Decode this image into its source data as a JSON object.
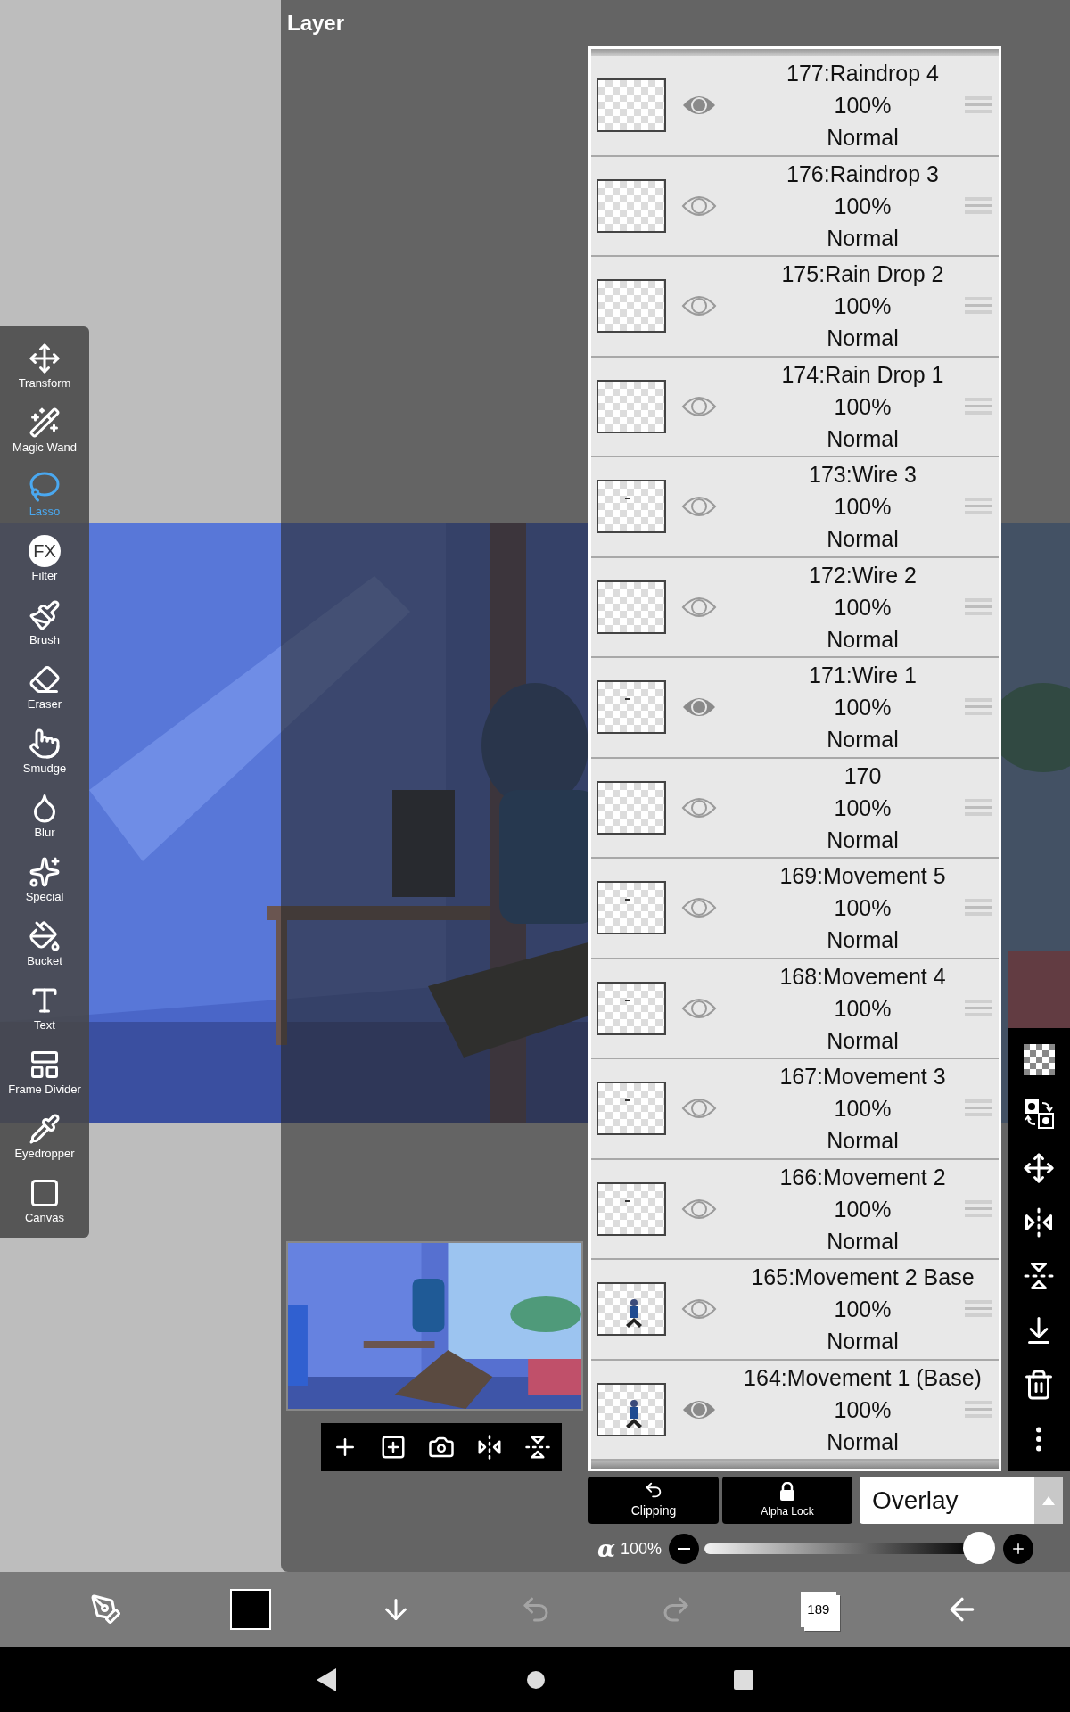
{
  "tools": [
    {
      "label": "Transform",
      "selected": false
    },
    {
      "label": "Magic Wand",
      "selected": false
    },
    {
      "label": "Lasso",
      "selected": true
    },
    {
      "label": "Filter",
      "selected": false,
      "icon_text": "FX"
    },
    {
      "label": "Brush",
      "selected": false
    },
    {
      "label": "Eraser",
      "selected": false
    },
    {
      "label": "Smudge",
      "selected": false
    },
    {
      "label": "Blur",
      "selected": false
    },
    {
      "label": "Special",
      "selected": false
    },
    {
      "label": "Bucket",
      "selected": false
    },
    {
      "label": "Text",
      "selected": false
    },
    {
      "label": "Frame Divider",
      "selected": false
    },
    {
      "label": "Eyedropper",
      "selected": false
    },
    {
      "label": "Canvas",
      "selected": false
    }
  ],
  "layer_panel": {
    "title": "Layer",
    "layers": [
      {
        "name": "177:Raindrop 4",
        "opacity": "100%",
        "blend": "Normal",
        "visible": true,
        "kind": "empty"
      },
      {
        "name": "176:Raindrop 3",
        "opacity": "100%",
        "blend": "Normal",
        "visible": false,
        "kind": "empty"
      },
      {
        "name": "175:Rain Drop 2",
        "opacity": "100%",
        "blend": "Normal",
        "visible": false,
        "kind": "empty"
      },
      {
        "name": "174:Rain Drop 1",
        "opacity": "100%",
        "blend": "Normal",
        "visible": false,
        "kind": "empty"
      },
      {
        "name": "173:Wire 3",
        "opacity": "100%",
        "blend": "Normal",
        "visible": false,
        "kind": "mark"
      },
      {
        "name": "172:Wire 2",
        "opacity": "100%",
        "blend": "Normal",
        "visible": false,
        "kind": "empty"
      },
      {
        "name": "171:Wire 1",
        "opacity": "100%",
        "blend": "Normal",
        "visible": true,
        "kind": "mark"
      },
      {
        "name": "170",
        "opacity": "100%",
        "blend": "Normal",
        "visible": false,
        "kind": "empty"
      },
      {
        "name": "169:Movement 5",
        "opacity": "100%",
        "blend": "Normal",
        "visible": false,
        "kind": "mark"
      },
      {
        "name": "168:Movement 4",
        "opacity": "100%",
        "blend": "Normal",
        "visible": false,
        "kind": "mark"
      },
      {
        "name": "167:Movement 3",
        "opacity": "100%",
        "blend": "Normal",
        "visible": false,
        "kind": "mark"
      },
      {
        "name": "166:Movement 2",
        "opacity": "100%",
        "blend": "Normal",
        "visible": false,
        "kind": "mark"
      },
      {
        "name": "165:Movement 2 Base",
        "opacity": "100%",
        "blend": "Normal",
        "visible": false,
        "kind": "figure"
      },
      {
        "name": "164:Movement 1 (Base)",
        "opacity": "100%",
        "blend": "Normal",
        "visible": true,
        "kind": "figure"
      }
    ],
    "clipping": "Clipping",
    "alpha_lock": "Alpha Lock",
    "blend_mode": "Overlay",
    "opacity": {
      "symbol": "α",
      "reading": "100%",
      "level": 1
    }
  },
  "bottom_bar": {
    "color": "#000000",
    "history": [
      {
        "kind": "undo",
        "disabled": true
      },
      {
        "kind": "redo",
        "disabled": true
      }
    ],
    "layer_count": "189"
  }
}
